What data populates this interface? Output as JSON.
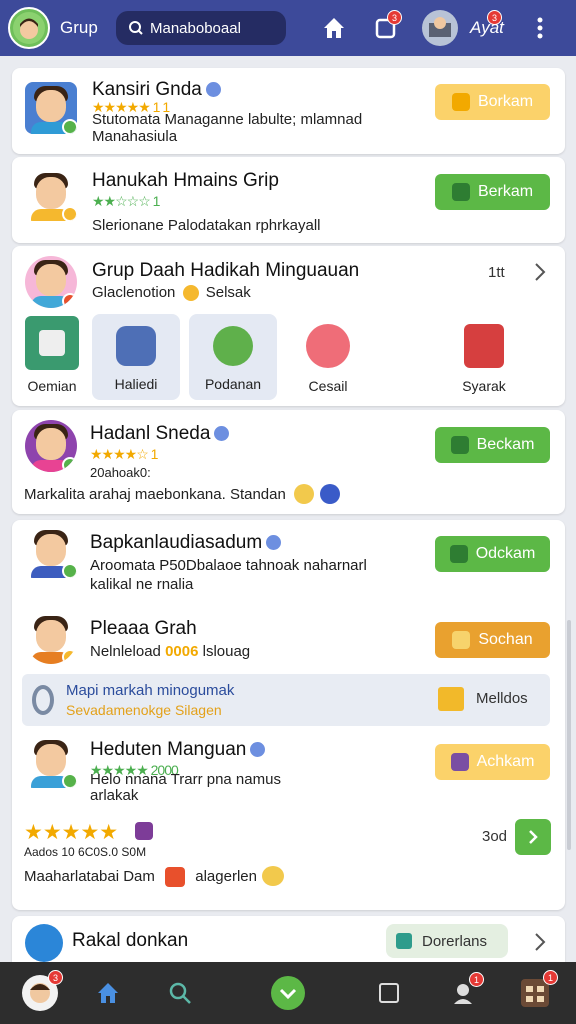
{
  "header": {
    "title": "Grup",
    "search_value": "Manaboboaal",
    "user_label": "Ayat",
    "badges": {
      "notifications": "3",
      "user": "3"
    },
    "icons": [
      "home-icon",
      "notification-square-icon",
      "user-avatar",
      "more-vert-icon"
    ]
  },
  "cards": [
    {
      "name": "Kansiri Gnda",
      "rating_text": "★★★★★ 1 1",
      "sub": "Stutomata Managanne labulte; mlamnad",
      "sub2": "Manahasiula",
      "button": "Borkam"
    },
    {
      "name": "Hanukah Hmains Grip",
      "rating_text": "★★☆☆☆ 1",
      "sub": "Slerionane Palodatakan rphrkayall",
      "button": "Berkam"
    },
    {
      "name": "Grup Daah Hadikah Minguauan",
      "count": "1tt",
      "sub": "Glaclenotion",
      "sub_extra": "Selsak",
      "categories": [
        "Oemian",
        "Haliedi",
        "Podanan",
        "Cesail",
        "Syarak"
      ]
    },
    {
      "name": "Hadanl Sneda",
      "rating_text": "★★★★☆ 1",
      "count_text": "20ahoak0:",
      "sub": "Markalita arahaj maebonkana. Standan",
      "button": "Beckam"
    },
    {
      "name": "Bapkanlaudiasadum",
      "sub": "Aroomata P50Dbalaoe tahnoak naharnarl",
      "sub2": "kalikal ne rnalia",
      "button": "Odckam"
    },
    {
      "name": "Pleaaa Grah",
      "sub": "Nelnleload",
      "sub_highlight": "0006",
      "sub_tail": "lslouag",
      "button": "Sochan"
    },
    {
      "banner_title": "Mapi markah minogumak",
      "banner_sub": "Sevadamenokge Silagen",
      "button": "Melldos"
    },
    {
      "name": "Heduten Manguan",
      "rating_text": "★★★★★ 2000",
      "sub": "Helo nnana  Trarr pna namus",
      "sub2": "arlakak",
      "button": "Achkam"
    },
    {
      "rating_text": "★★★★★",
      "count_text": "Aados 10 6C0S.0 S0M",
      "footer_text": "Maaharlatabai Dam",
      "footer_tail": "alagerlen",
      "side_count": "3od"
    },
    {
      "name": "Rakal donkan",
      "button": "Dorerlans"
    }
  ],
  "bottom_nav": {
    "badges": [
      "3",
      "1",
      "1"
    ],
    "items": [
      "profile-avatar",
      "home-icon",
      "search-icon",
      "center-action-icon",
      "square-icon",
      "pin-user-icon",
      "grid-apps-icon"
    ]
  },
  "colors": {
    "header_bg": "#3d4a9a",
    "search_bg": "#252c63",
    "green": "#5cb846",
    "yellow": "#fbd26a",
    "orange": "#e9a12f",
    "bottom_bg": "#2d2d2d"
  }
}
